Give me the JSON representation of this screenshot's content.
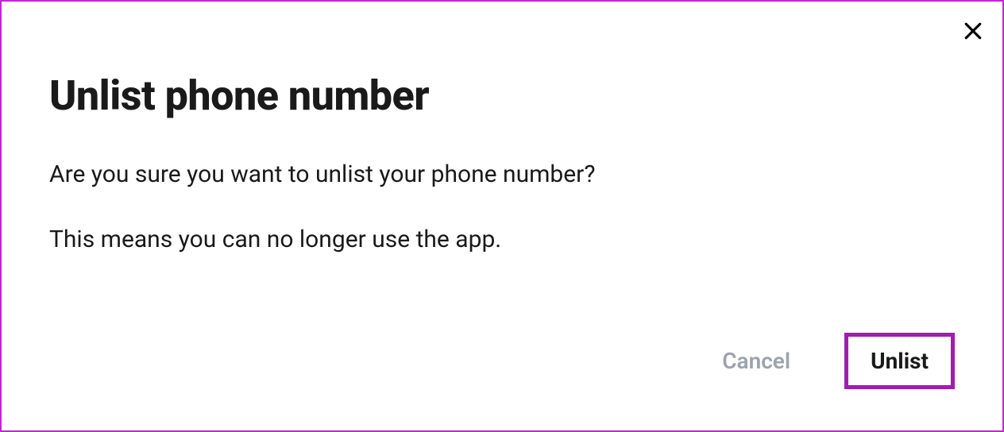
{
  "modal": {
    "title": "Unlist phone number",
    "body_line1": "Are you sure you want to unlist your phone number?",
    "body_line2": "This means you can no longer use the app.",
    "cancel_label": "Cancel",
    "confirm_label": "Unlist"
  }
}
